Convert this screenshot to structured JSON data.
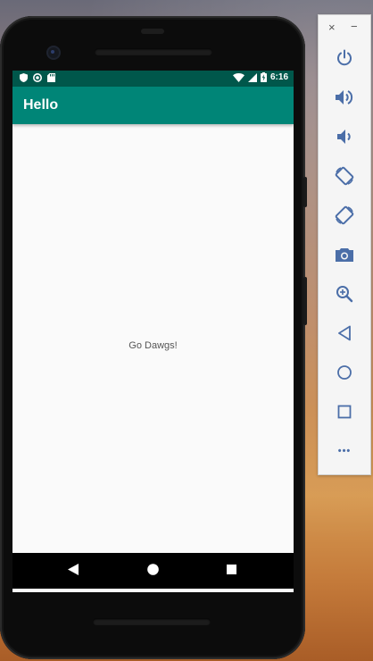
{
  "app": {
    "title": "Hello",
    "message": "Go Dawgs!"
  },
  "statusbar": {
    "time": "6:16",
    "icons": [
      "shield-icon",
      "circle-sync-icon",
      "sd-card-icon",
      "wifi-icon",
      "signal-icon",
      "battery-charging-icon"
    ]
  },
  "navbar": {
    "icons": [
      "back-icon",
      "home-icon",
      "recents-icon"
    ]
  },
  "emulator_toolbar": {
    "close_label": "×",
    "minimize_label": "−",
    "buttons": [
      "power-icon",
      "volume-up-icon",
      "volume-down-icon",
      "rotate-left-icon",
      "rotate-right-icon",
      "camera-icon",
      "zoom-icon",
      "back-icon",
      "home-icon",
      "overview-icon",
      "more-icon"
    ],
    "more_label": "•••"
  },
  "colors": {
    "statusbar": "#00574b",
    "appbar": "#008577",
    "toolbar_icon": "#4b6ea8"
  }
}
